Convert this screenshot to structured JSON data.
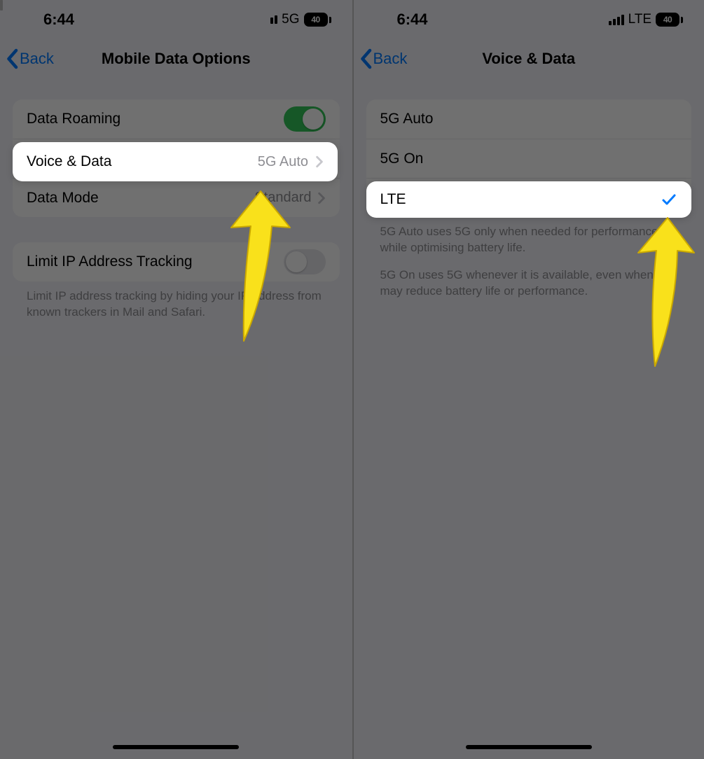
{
  "left": {
    "status": {
      "time": "6:44",
      "net": "5G",
      "batt": "40"
    },
    "nav": {
      "back": "Back",
      "title": "Mobile Data Options"
    },
    "rows": {
      "dataRoaming": "Data Roaming",
      "voiceData": {
        "label": "Voice & Data",
        "value": "5G Auto"
      },
      "dataMode": {
        "label": "Data Mode",
        "value": "Standard"
      },
      "limitIP": "Limit IP Address Tracking"
    },
    "footer": "Limit IP address tracking by hiding your IP address from known trackers in Mail and Safari."
  },
  "right": {
    "status": {
      "time": "6:44",
      "net": "LTE",
      "batt": "40"
    },
    "nav": {
      "back": "Back",
      "title": "Voice & Data"
    },
    "options": {
      "auto": "5G Auto",
      "on": "5G On",
      "lte": "LTE"
    },
    "footer1": "5G Auto uses 5G only when needed for performance while optimising battery life.",
    "footer2": "5G On uses 5G whenever it is available, even when it may reduce battery life or performance."
  }
}
